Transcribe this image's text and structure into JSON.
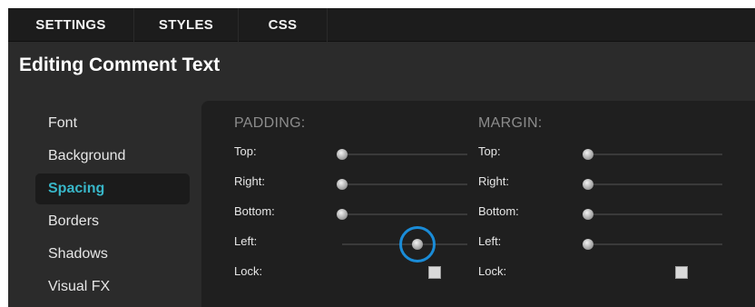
{
  "tabs": [
    {
      "label": "SETTINGS"
    },
    {
      "label": "STYLES"
    },
    {
      "label": "CSS"
    }
  ],
  "page_title": "Editing Comment Text",
  "sidebar": {
    "items": [
      {
        "label": "Font",
        "active": false
      },
      {
        "label": "Background",
        "active": false
      },
      {
        "label": "Spacing",
        "active": true
      },
      {
        "label": "Borders",
        "active": false
      },
      {
        "label": "Shadows",
        "active": false
      },
      {
        "label": "Visual FX",
        "active": false
      }
    ]
  },
  "padding": {
    "heading": "PADDING:",
    "top_label": "Top:",
    "right_label": "Right:",
    "bottom_label": "Bottom:",
    "left_label": "Left:",
    "lock_label": "Lock:",
    "levels": {
      "top": 0,
      "right": 0,
      "bottom": 0,
      "left": 0.6
    },
    "lock_checked": false
  },
  "margin": {
    "heading": "MARGIN:",
    "top_label": "Top:",
    "right_label": "Right:",
    "bottom_label": "Bottom:",
    "left_label": "Left:",
    "lock_label": "Lock:",
    "levels": {
      "top": 0,
      "right": 0,
      "bottom": 0,
      "left": 0
    },
    "lock_checked": false
  },
  "colors": {
    "accent": "#38b6c8",
    "focus": "#1a8cd8"
  }
}
